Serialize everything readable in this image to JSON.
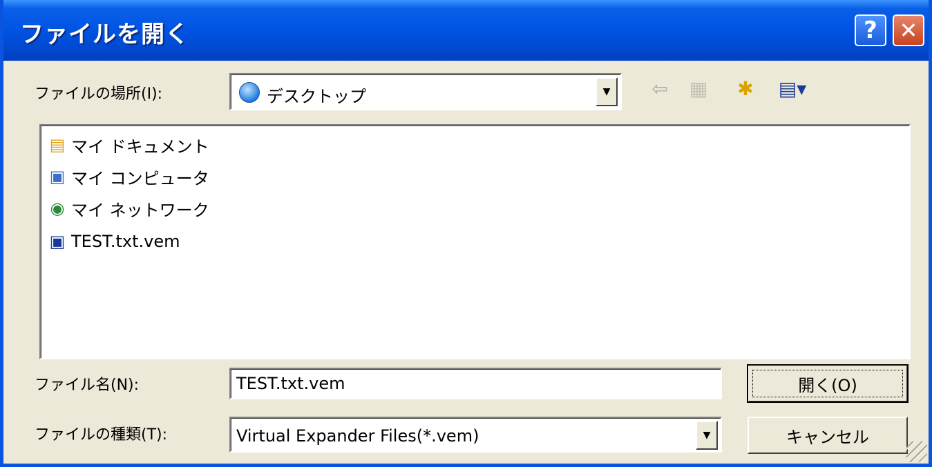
{
  "window": {
    "title": "ファイルを開く",
    "help_glyph": "?",
    "close_glyph": "✕"
  },
  "lookin": {
    "label": "ファイルの場所(I):",
    "value": "デスクトップ",
    "icon": "desktop-icon"
  },
  "toolbar": {
    "back_glyph": "⇦",
    "up_glyph": "▦",
    "new_folder_glyph": "✱",
    "view_glyph": "▤▾"
  },
  "files": [
    {
      "name": "マイ ドキュメント",
      "icon": "my-documents-icon"
    },
    {
      "name": "マイ コンピュータ",
      "icon": "my-computer-icon"
    },
    {
      "name": "マイ ネットワーク",
      "icon": "my-network-icon"
    },
    {
      "name": "TEST.txt.vem",
      "icon": "vem-file-icon"
    }
  ],
  "filename": {
    "label": "ファイル名(N):",
    "value": "TEST.txt.vem"
  },
  "filetype": {
    "label": "ファイルの種類(T):",
    "value": "Virtual Expander Files(*.vem)"
  },
  "buttons": {
    "open": "開く(O)",
    "cancel": "キャンセル"
  },
  "colors": {
    "titlebar": "#0055e5",
    "dialog_bg": "#ece9d8",
    "close_button": "#c9421f"
  }
}
